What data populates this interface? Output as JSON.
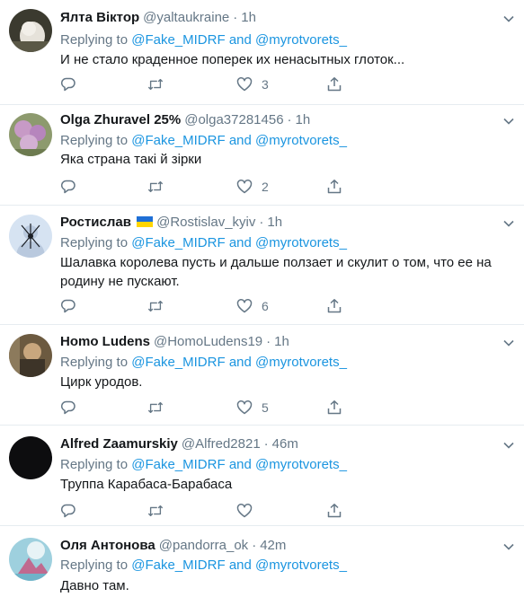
{
  "common": {
    "replying_prefix": "Replying to",
    "mention1": "@Fake_MIDRF",
    "and": "and",
    "mention2": "@myrotvorets_",
    "dot": "·"
  },
  "tweets": [
    {
      "name": "Ялта Віктор",
      "handle": "@yaltaukraine",
      "time": "1h",
      "text": "И не стало краденное поперек их ненасытных глоток...",
      "likes": "3"
    },
    {
      "name": "Olga Zhuravel 25%",
      "handle": "@olga37281456",
      "time": "1h",
      "text": "Яка страна такі й зірки",
      "likes": "2"
    },
    {
      "name": "Ростислав",
      "handle": "@Rostislav_kyiv",
      "time": "1h",
      "text": "Шалавка королева пусть и дальше ползает и скулит о том, что ее на родину не пускают.",
      "likes": "6"
    },
    {
      "name": "Homo Ludens",
      "handle": "@HomoLudens19",
      "time": "1h",
      "text": "Цирк уродов.",
      "likes": "5"
    },
    {
      "name": "Alfred Zaamurskiy",
      "handle": "@Alfred2821",
      "time": "46m",
      "text": "Труппа Карабаса-Барабаса",
      "likes": ""
    },
    {
      "name": "Оля Антонова",
      "handle": "@pandorra_ok",
      "time": "42m",
      "text": "Давно там.",
      "likes": ""
    }
  ],
  "icons": [
    "reply-icon",
    "retweet-icon",
    "like-icon",
    "share-icon",
    "chevron-down-icon",
    "ukraine-flag-icon"
  ],
  "colors": {
    "link": "#1b95e0",
    "muted": "#657786",
    "text": "#14171a",
    "divider": "#e6ecf0"
  }
}
